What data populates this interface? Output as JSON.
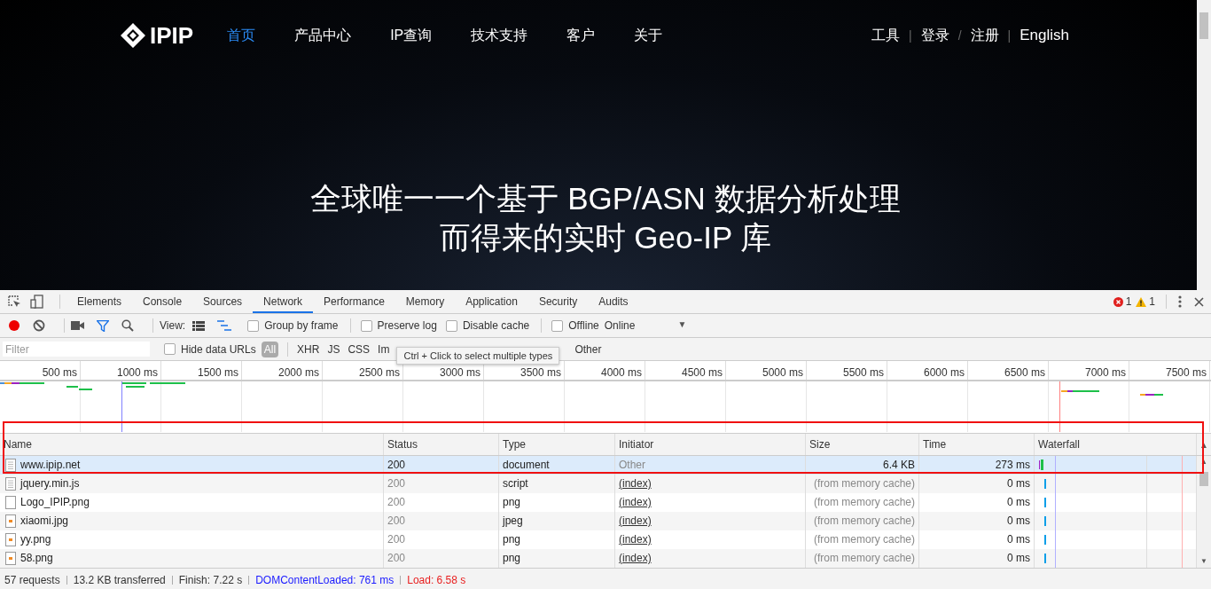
{
  "site": {
    "logo": "IPIP",
    "nav": [
      {
        "label": "首页",
        "selected": true
      },
      {
        "label": "产品中心",
        "selected": false
      },
      {
        "label": "IP查询",
        "selected": false
      },
      {
        "label": "技术支持",
        "selected": false
      },
      {
        "label": "客户",
        "selected": false
      },
      {
        "label": "关于",
        "selected": false
      }
    ],
    "account_links": [
      {
        "kind": "link",
        "label": "工具"
      },
      {
        "kind": "separator",
        "label": "|"
      },
      {
        "kind": "link",
        "label": "登录"
      },
      {
        "kind": "separator",
        "label": "/"
      },
      {
        "kind": "link",
        "label": "注册"
      },
      {
        "kind": "separator",
        "label": "|"
      },
      {
        "kind": "link",
        "label": "English"
      }
    ],
    "headline": [
      "全球唯一一个基于 BGP/ASN 数据分析处理",
      "而得来的实时 Geo-IP 库"
    ]
  },
  "devtools": {
    "tabs": [
      {
        "label": "Elements",
        "selected": false
      },
      {
        "label": "Console",
        "selected": false
      },
      {
        "label": "Sources",
        "selected": false
      },
      {
        "label": "Network",
        "selected": true
      },
      {
        "label": "Performance",
        "selected": false
      },
      {
        "label": "Memory",
        "selected": false
      },
      {
        "label": "Application",
        "selected": false
      },
      {
        "label": "Security",
        "selected": false
      },
      {
        "label": "Audits",
        "selected": false
      }
    ],
    "errors": "1",
    "warnings": "1",
    "toolbar": {
      "recording": true,
      "filter_active": true,
      "view_label": "View:",
      "large_rows": false,
      "waterfall_view": true,
      "checkboxes": [
        {
          "label": "Group by frame",
          "checked": false
        },
        {
          "label": "Preserve log",
          "checked": false
        },
        {
          "label": "Disable cache",
          "checked": false
        },
        {
          "label": "Offline",
          "checked": false
        }
      ],
      "throttling": "Online",
      "dropdown_arrow": "▼"
    },
    "filter_bar": {
      "placeholder": "Filter",
      "hide_data_urls": {
        "label": "Hide data URLs",
        "checked": false
      },
      "types": [
        {
          "label": "All",
          "selected": true
        },
        {
          "label": "XHR",
          "selected": false
        },
        {
          "label": "JS",
          "selected": false
        },
        {
          "label": "CSS",
          "selected": false
        },
        {
          "label": "Im",
          "selected": false
        },
        {
          "label": "Other",
          "selected": false
        }
      ],
      "tooltip": "Ctrl + Click to select multiple types"
    },
    "overview": {
      "ticks": [
        "500 ms",
        "1000 ms",
        "1500 ms",
        "2000 ms",
        "2500 ms",
        "3000 ms",
        "3500 ms",
        "4000 ms",
        "4500 ms",
        "5000 ms",
        "5500 ms",
        "6000 ms",
        "6500 ms",
        "7000 ms",
        "7500 ms"
      ]
    },
    "table": {
      "columns": [
        "Name",
        "Status",
        "Type",
        "Initiator",
        "Size",
        "Time",
        "Waterfall"
      ],
      "sort_arrow": "▲",
      "rows": [
        {
          "name": "www.ipip.net",
          "kind": "document",
          "status": "200",
          "type": "document",
          "initiator": "Other",
          "initiator_link": false,
          "size": "6.4 KB",
          "time": "273 ms",
          "cached": false,
          "selected": true
        },
        {
          "name": "jquery.min.js",
          "kind": "document",
          "status": "200",
          "type": "script",
          "initiator": "(index)",
          "initiator_link": true,
          "size": "(from memory cache)",
          "time": "0 ms",
          "cached": true,
          "selected": false
        },
        {
          "name": "Logo_IPIP.png",
          "kind": "blank",
          "status": "200",
          "type": "png",
          "initiator": "(index)",
          "initiator_link": true,
          "size": "(from memory cache)",
          "time": "0 ms",
          "cached": true,
          "selected": false
        },
        {
          "name": "xiaomi.jpg",
          "kind": "image",
          "status": "200",
          "type": "jpeg",
          "initiator": "(index)",
          "initiator_link": true,
          "size": "(from memory cache)",
          "time": "0 ms",
          "cached": true,
          "selected": false
        },
        {
          "name": "yy.png",
          "kind": "image",
          "status": "200",
          "type": "png",
          "initiator": "(index)",
          "initiator_link": true,
          "size": "(from memory cache)",
          "time": "0 ms",
          "cached": true,
          "selected": false
        },
        {
          "name": "58.png",
          "kind": "image",
          "status": "200",
          "type": "png",
          "initiator": "(index)",
          "initiator_link": true,
          "size": "(from memory cache)",
          "time": "0 ms",
          "cached": true,
          "selected": false
        }
      ],
      "scroll_up": "▲",
      "scroll_down": "▼"
    },
    "status_bar": [
      {
        "text": "57 requests",
        "color": "#333333"
      },
      {
        "text": "13.2 KB transferred",
        "color": "#333333"
      },
      {
        "text": "Finish: 7.22 s",
        "color": "#333333"
      },
      {
        "text": "DOMContentLoaded: 761 ms",
        "color": "#1a1aff"
      },
      {
        "text": "Load: 6.58 s",
        "color": "#e82020"
      }
    ]
  }
}
